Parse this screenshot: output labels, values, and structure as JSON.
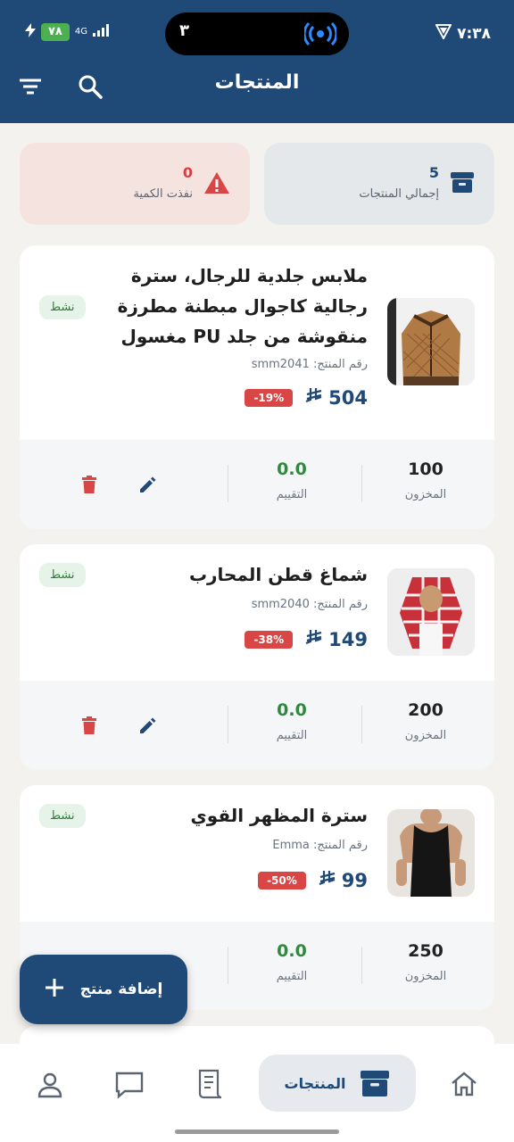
{
  "status": {
    "time": "٧:٣٨",
    "battery": "٧٨",
    "network": "4G",
    "island_number": "٣"
  },
  "header": {
    "title": "المنتجات"
  },
  "summary": {
    "total": {
      "value": "5",
      "label": "إجمالي المنتجات"
    },
    "out_of_stock": {
      "value": "0",
      "label": "نفذت الكمية"
    }
  },
  "products": [
    {
      "title": "ملابس جلدية للرجال، سترة رجالية كاجوال مبطنة مطرزة منقوشة من جلد PU مغسول",
      "code_label": "رقم المنتج:",
      "code": "smm2041",
      "price": "504",
      "discount": "-19%",
      "status": "نشط",
      "stock": "100",
      "stock_label": "المخزون",
      "rating": "0.0",
      "rating_label": "التقييم"
    },
    {
      "title": "شماغ قطن المحارب",
      "code_label": "رقم المنتج:",
      "code": "smm2040",
      "price": "149",
      "discount": "-38%",
      "status": "نشط",
      "stock": "200",
      "stock_label": "المخزون",
      "rating": "0.0",
      "rating_label": "التقييم"
    },
    {
      "title": "سترة المظهر القوي",
      "code_label": "رقم المنتج:",
      "code": "Emma",
      "price": "99",
      "discount": "-50%",
      "status": "نشط",
      "stock": "250",
      "stock_label": "المخزون",
      "rating": "0.0",
      "rating_label": "التقييم"
    }
  ],
  "fab": {
    "label": "إضافة منتج"
  },
  "nav": {
    "active_label": "المنتجات"
  },
  "colors": {
    "primary": "#1f4a78",
    "danger": "#d94646",
    "success": "#2f7d3a"
  }
}
